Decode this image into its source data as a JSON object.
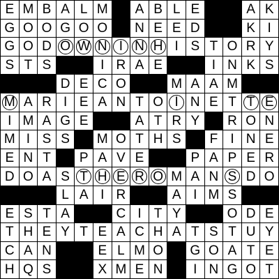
{
  "grid": {
    "rows": [
      "EMBALM#ABLE##AKA",
      "GOOGOO#NEED##KIM",
      "GODOWNINHISTORY",
      "STS##IRAE##INKS",
      "###DECO##MAAM###",
      "MARIEANTOINETTE",
      "IMAGE##ATRY#RON",
      "MISS#MOTHS#FINE",
      "ENT#PAVE##PAPER",
      "DOASTHEROMANSDO",
      "###LAIR##AIMS###",
      "ESTA##CITY##ODE",
      "THEYTEACHATSTUY",
      "CAN##ELMO#GOATEE",
      "HQS##XMEN#INGOTS"
    ],
    "circled": [
      [
        2,
        3
      ],
      [
        2,
        4
      ],
      [
        2,
        5
      ],
      [
        2,
        6
      ],
      [
        2,
        7
      ],
      [
        2,
        8
      ],
      [
        5,
        0
      ],
      [
        5,
        9
      ],
      [
        5,
        13
      ],
      [
        5,
        14
      ],
      [
        9,
        4
      ],
      [
        9,
        5
      ],
      [
        9,
        6
      ],
      [
        9,
        7
      ],
      [
        9,
        8
      ],
      [
        9,
        12
      ]
    ]
  }
}
